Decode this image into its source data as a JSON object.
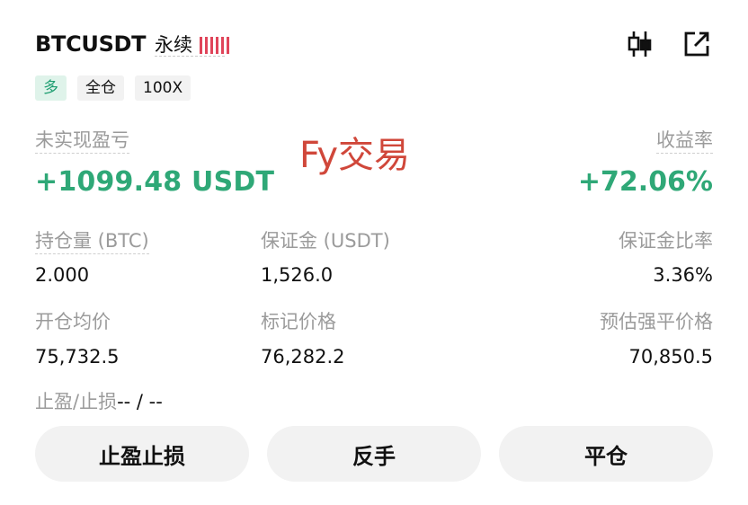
{
  "header": {
    "symbol": "BTCUSDT",
    "contract_type": "永续",
    "leverage_bars": 6,
    "leverage_bar_color": "#e0455a",
    "icons": [
      "candlestick-chart-icon",
      "share-external-icon"
    ]
  },
  "tags": {
    "side": "多",
    "margin_mode": "全仓",
    "leverage": "100X"
  },
  "pnl": {
    "label": "未实现盈亏",
    "value": "+1099.48 USDT",
    "color": "#2fa877"
  },
  "roi": {
    "label": "收益率",
    "value": "+72.06%"
  },
  "watermark": "Fy交易",
  "stats": {
    "position_size_label": "持仓量 (BTC)",
    "position_size_value": "2.000",
    "margin_label": "保证金 (USDT)",
    "margin_value": "1,526.0",
    "margin_ratio_label": "保证金比率",
    "margin_ratio_value": "3.36%",
    "entry_price_label": "开仓均价",
    "entry_price_value": "75,732.5",
    "mark_price_label": "标记价格",
    "mark_price_value": "76,282.2",
    "liq_price_label": "预估强平价格",
    "liq_price_value": "70,850.5"
  },
  "tpsl": {
    "label": "止盈/止损",
    "value": "-- / --"
  },
  "buttons": {
    "tpsl": "止盈止损",
    "reverse": "反手",
    "close": "平仓"
  }
}
